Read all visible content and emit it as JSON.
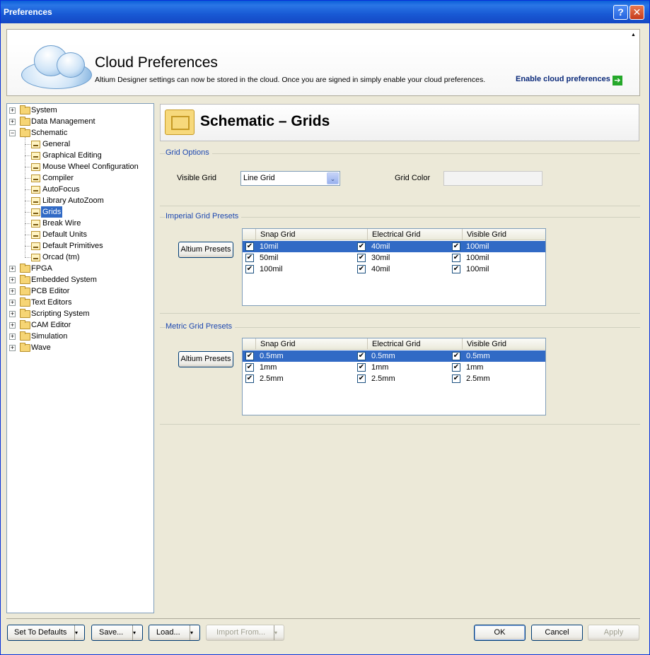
{
  "window": {
    "title": "Preferences",
    "help_glyph": "?",
    "close_glyph": "✕"
  },
  "cloud": {
    "title": "Cloud Preferences",
    "description": "Altium Designer settings can now be stored in the cloud. Once you are signed in simply enable your cloud preferences.",
    "link": "Enable cloud preferences",
    "link_arrow": "➔"
  },
  "tree": {
    "items": [
      {
        "label": "System",
        "expander": "+"
      },
      {
        "label": "Data Management",
        "expander": "+"
      },
      {
        "label": "Schematic",
        "expander": "−"
      },
      {
        "label": "General"
      },
      {
        "label": "Graphical Editing"
      },
      {
        "label": "Mouse Wheel Configuration"
      },
      {
        "label": "Compiler"
      },
      {
        "label": "AutoFocus"
      },
      {
        "label": "Library AutoZoom"
      },
      {
        "label": "Grids",
        "selected": true
      },
      {
        "label": "Break Wire"
      },
      {
        "label": "Default Units"
      },
      {
        "label": "Default Primitives"
      },
      {
        "label": "Orcad (tm)"
      },
      {
        "label": "FPGA",
        "expander": "+"
      },
      {
        "label": "Embedded System",
        "expander": "+"
      },
      {
        "label": "PCB Editor",
        "expander": "+"
      },
      {
        "label": "Text Editors",
        "expander": "+"
      },
      {
        "label": "Scripting System",
        "expander": "+"
      },
      {
        "label": "CAM Editor",
        "expander": "+"
      },
      {
        "label": "Simulation",
        "expander": "+"
      },
      {
        "label": "Wave",
        "expander": "+"
      }
    ]
  },
  "page": {
    "title": "Schematic – Grids"
  },
  "grid_options": {
    "title": "Grid Options",
    "visible_grid_label": "Visible Grid",
    "visible_grid_value": "Line Grid",
    "grid_color_label": "Grid Color",
    "combo_arrow": "⌄"
  },
  "imperial": {
    "title": "Imperial Grid Presets",
    "button": "Altium Presets",
    "columns": [
      "Snap Grid",
      "Electrical Grid",
      "Visible Grid"
    ],
    "rows": [
      {
        "snap": "10mil",
        "electrical": "40mil",
        "visible": "100mil",
        "selected": true
      },
      {
        "snap": "50mil",
        "electrical": "30mil",
        "visible": "100mil"
      },
      {
        "snap": "100mil",
        "electrical": "40mil",
        "visible": "100mil"
      }
    ]
  },
  "metric": {
    "title": "Metric Grid Presets",
    "button": "Altium Presets",
    "columns": [
      "Snap Grid",
      "Electrical Grid",
      "Visible Grid"
    ],
    "rows": [
      {
        "snap": "0.5mm",
        "electrical": "0.5mm",
        "visible": "0.5mm",
        "selected": true
      },
      {
        "snap": "1mm",
        "electrical": "1mm",
        "visible": "1mm"
      },
      {
        "snap": "2.5mm",
        "electrical": "2.5mm",
        "visible": "2.5mm"
      }
    ]
  },
  "check_glyph": "✔",
  "footer": {
    "set_defaults": "Set To Defaults",
    "save": "Save...",
    "load": "Load...",
    "import_from": "Import From...",
    "split_glyph": "▾",
    "ok": "OK",
    "cancel": "Cancel",
    "apply": "Apply"
  }
}
